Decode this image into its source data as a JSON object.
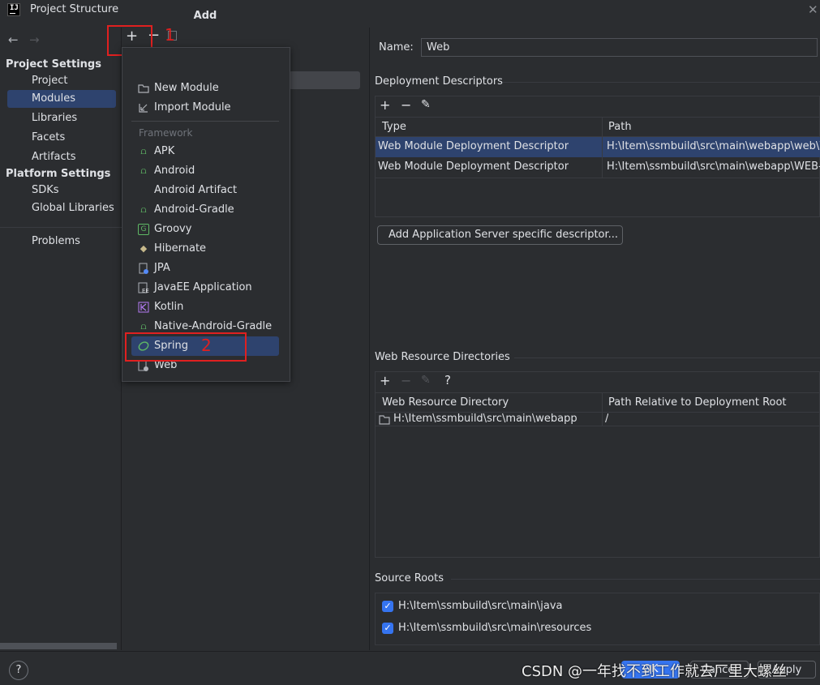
{
  "window": {
    "title": "Project Structure",
    "logo": "IJ"
  },
  "nav": {
    "back_icon": "arrow-left-icon",
    "forward_icon": "arrow-right-icon",
    "project_settings_header": "Project Settings",
    "project_settings": [
      "Project",
      "Modules",
      "Libraries",
      "Facets",
      "Artifacts"
    ],
    "platform_settings_header": "Platform Settings",
    "platform_settings": [
      "SDKs",
      "Global Libraries"
    ],
    "problems": "Problems",
    "selected": "Modules"
  },
  "toolbar": {
    "add": "+",
    "remove": "−"
  },
  "annotations": {
    "one": "1",
    "two": "2"
  },
  "popup": {
    "title": "Add",
    "actions": [
      {
        "label": "New Module",
        "icon": "folder-icon"
      },
      {
        "label": "Import Module",
        "icon": "import-icon"
      }
    ],
    "group_label": "Framework",
    "frameworks": [
      {
        "label": "APK",
        "icon": "android-icon"
      },
      {
        "label": "Android",
        "icon": "android-icon"
      },
      {
        "label": "Android Artifact",
        "icon": ""
      },
      {
        "label": "Android-Gradle",
        "icon": "android-icon"
      },
      {
        "label": "Groovy",
        "icon": "groovy-icon"
      },
      {
        "label": "Hibernate",
        "icon": "hibernate-icon"
      },
      {
        "label": "JPA",
        "icon": "jpa-icon"
      },
      {
        "label": "JavaEE Application",
        "icon": "javaee-icon"
      },
      {
        "label": "Kotlin",
        "icon": "kotlin-icon"
      },
      {
        "label": "Native-Android-Gradle",
        "icon": "android-icon"
      },
      {
        "label": "Spring",
        "icon": "spring-icon"
      },
      {
        "label": "Web",
        "icon": "web-icon"
      }
    ],
    "selected": "Spring"
  },
  "details": {
    "name_label": "Name:",
    "name_value": "Web",
    "deployment": {
      "title": "Deployment Descriptors",
      "headers": [
        "Type",
        "Path"
      ],
      "rows": [
        [
          "Web Module Deployment Descriptor",
          "H:\\Item\\ssmbuild\\src\\main\\webapp\\web\\W"
        ],
        [
          "Web Module Deployment Descriptor",
          "H:\\Item\\ssmbuild\\src\\main\\webapp\\WEB-II"
        ]
      ],
      "add_server_button": "Add Application Server specific descriptor..."
    },
    "web_resources": {
      "title": "Web Resource Directories",
      "help": "?",
      "headers": [
        "Web Resource Directory",
        "Path Relative to Deployment Root"
      ],
      "rows": [
        [
          "H:\\Item\\ssmbuild\\src\\main\\webapp",
          "/"
        ]
      ]
    },
    "source_roots": {
      "title": "Source Roots",
      "items": [
        {
          "path": "H:\\Item\\ssmbuild\\src\\main\\java",
          "checked": true
        },
        {
          "path": "H:\\Item\\ssmbuild\\src\\main\\resources",
          "checked": true
        }
      ]
    }
  },
  "footer": {
    "help": "?",
    "ok": "OK",
    "cancel": "Cancel",
    "apply": "Apply",
    "watermark": "CSDN @一年找不到工作就去厂里大螺丝"
  },
  "colors": {
    "selection": "#2e436e",
    "accent": "#3574f0",
    "annotation": "#e02020"
  }
}
